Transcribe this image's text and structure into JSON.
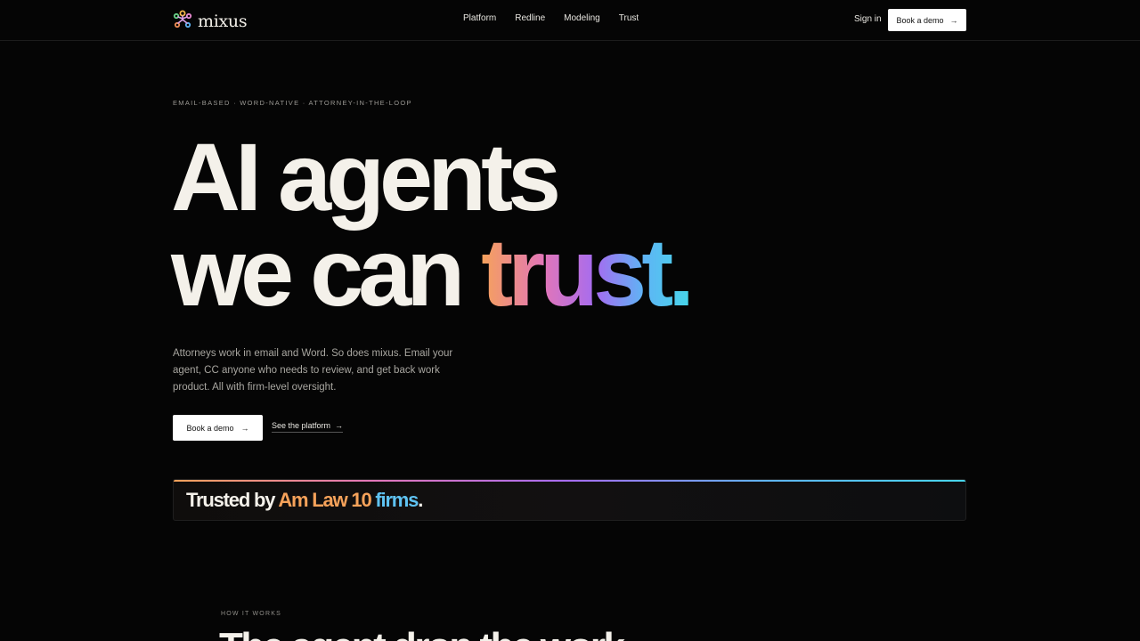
{
  "nav": {
    "logo_text": "mixus",
    "links": [
      "Platform",
      "Redline",
      "Modeling",
      "Trust"
    ],
    "signin_label": "Sign in",
    "demo_label": "Book a demo"
  },
  "hero": {
    "eyebrow": "EMAIL-BASED · WORD-NATIVE · ATTORNEY-IN-THE-LOOP",
    "headline_line1": "AI agents",
    "headline_line2_plain": "we can ",
    "headline_line2_gradient": "trust.",
    "lede": "Attorneys work in email and Word. So does mixus. Email your agent, CC anyone who needs to review, and get back work product. All with firm-level oversight.",
    "primary_cta": "Book a demo",
    "secondary_cta": "See the platform"
  },
  "trust": {
    "prefix": "Trusted by ",
    "highlight1": "Am Law 10",
    "highlight2": "firms",
    "suffix": "."
  },
  "how": {
    "label": "HOW IT WORKS",
    "title": "The agent drop the work"
  },
  "colors": {
    "background": "#050505",
    "text": "#f4f1ea",
    "gradient": [
      "#f6a25a",
      "#e276b8",
      "#a56cf0",
      "#5fb4f5",
      "#47d5ea"
    ]
  },
  "icons": [
    "logo-icon",
    "arrow-right-icon"
  ]
}
